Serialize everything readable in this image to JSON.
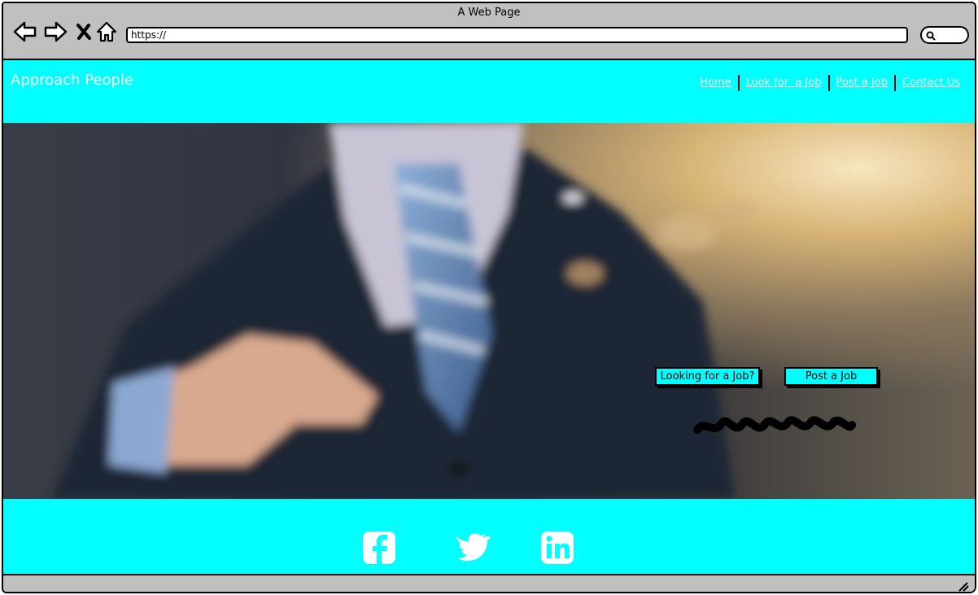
{
  "browser": {
    "title": "A Web Page",
    "url": "https://",
    "icons": [
      "back-arrow-icon",
      "forward-arrow-icon",
      "close-icon",
      "home-icon",
      "search-icon"
    ]
  },
  "site": {
    "brand": "Approach People",
    "nav": [
      {
        "label": "Home"
      },
      {
        "label": "Look for  a Job"
      },
      {
        "label": "Post a Job"
      },
      {
        "label": "Contact Us"
      }
    ]
  },
  "hero": {
    "cta_primary": "Looking for a Job?",
    "cta_secondary": "Post a Job"
  },
  "footer": {
    "social": [
      "facebook-icon",
      "twitter-icon",
      "linkedin-icon"
    ]
  },
  "colors": {
    "accent": "#00ffff",
    "chrome": "#c0c0c0",
    "outline": "#000000"
  }
}
